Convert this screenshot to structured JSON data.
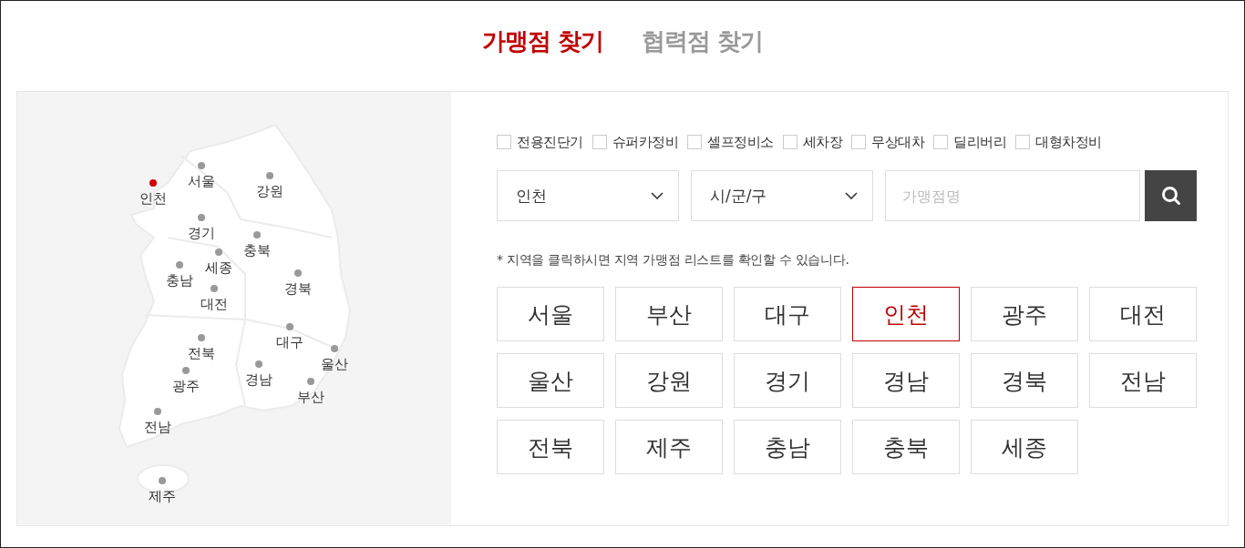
{
  "tabs": [
    {
      "label": "가맹점 찾기",
      "selected": true
    },
    {
      "label": "협력점 찾기",
      "selected": false
    }
  ],
  "map": {
    "regions": [
      {
        "label": "인천",
        "selected": true
      },
      {
        "label": "서울",
        "selected": false
      },
      {
        "label": "강원",
        "selected": false
      },
      {
        "label": "경기",
        "selected": false
      },
      {
        "label": "충북",
        "selected": false
      },
      {
        "label": "세종",
        "selected": false
      },
      {
        "label": "충남",
        "selected": false
      },
      {
        "label": "대전",
        "selected": false
      },
      {
        "label": "경북",
        "selected": false
      },
      {
        "label": "대구",
        "selected": false
      },
      {
        "label": "전북",
        "selected": false
      },
      {
        "label": "울산",
        "selected": false
      },
      {
        "label": "경남",
        "selected": false
      },
      {
        "label": "광주",
        "selected": false
      },
      {
        "label": "부산",
        "selected": false
      },
      {
        "label": "전남",
        "selected": false
      },
      {
        "label": "제주",
        "selected": false
      }
    ]
  },
  "filters": [
    {
      "label": "전용진단기",
      "checked": false
    },
    {
      "label": "슈퍼카정비",
      "checked": false
    },
    {
      "label": "셀프정비소",
      "checked": false
    },
    {
      "label": "세차장",
      "checked": false
    },
    {
      "label": "무상대차",
      "checked": false
    },
    {
      "label": "딜리버리",
      "checked": false
    },
    {
      "label": "대형차정비",
      "checked": false
    }
  ],
  "region_select": {
    "value": "인천"
  },
  "district_select": {
    "value": "시/군/구"
  },
  "search": {
    "placeholder": "가맹점명"
  },
  "note": "* 지역을 클릭하시면 지역 가맹점 리스트를 확인할 수 있습니다.",
  "region_buttons": [
    {
      "label": "서울",
      "selected": false
    },
    {
      "label": "부산",
      "selected": false
    },
    {
      "label": "대구",
      "selected": false
    },
    {
      "label": "인천",
      "selected": true
    },
    {
      "label": "광주",
      "selected": false
    },
    {
      "label": "대전",
      "selected": false
    },
    {
      "label": "울산",
      "selected": false
    },
    {
      "label": "강원",
      "selected": false
    },
    {
      "label": "경기",
      "selected": false
    },
    {
      "label": "경남",
      "selected": false
    },
    {
      "label": "경북",
      "selected": false
    },
    {
      "label": "전남",
      "selected": false
    },
    {
      "label": "전북",
      "selected": false
    },
    {
      "label": "제주",
      "selected": false
    },
    {
      "label": "충남",
      "selected": false
    },
    {
      "label": "충북",
      "selected": false
    },
    {
      "label": "세종",
      "selected": false
    }
  ]
}
